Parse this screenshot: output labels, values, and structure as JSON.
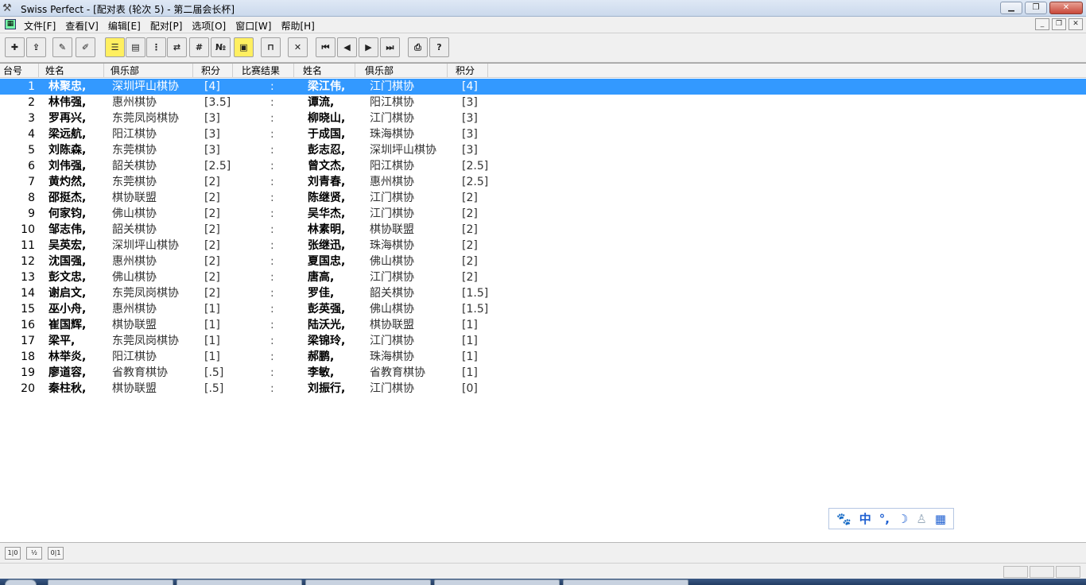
{
  "window": {
    "title": "Swiss Perfect - [配对表  (轮次 5) - 第二届会长杯]"
  },
  "menu": {
    "items": [
      "文件[F]",
      "查看[V]",
      "编辑[E]",
      "配对[P]",
      "选项[O]",
      "窗口[W]",
      "帮助[H]"
    ]
  },
  "columns": {
    "board": "台号",
    "name1": "姓名",
    "club1": "俱乐部",
    "pts1": "积分",
    "result": "比赛结果",
    "name2": "姓名",
    "club2": "俱乐部",
    "pts2": "积分"
  },
  "pairings": [
    {
      "board": "1",
      "name1": "林聚忠,",
      "club1": "深圳坪山棋协",
      "pts1": "[4]",
      "result": ":",
      "name2": "梁江伟,",
      "club2": "江门棋协",
      "pts2": "[4]"
    },
    {
      "board": "2",
      "name1": "林伟强,",
      "club1": "惠州棋协",
      "pts1": "[3.5]",
      "result": ":",
      "name2": "谭流,",
      "club2": "阳江棋协",
      "pts2": "[3]"
    },
    {
      "board": "3",
      "name1": "罗再兴,",
      "club1": "东莞凤岗棋协",
      "pts1": "[3]",
      "result": ":",
      "name2": "柳晓山,",
      "club2": "江门棋协",
      "pts2": "[3]"
    },
    {
      "board": "4",
      "name1": "梁远航,",
      "club1": "阳江棋协",
      "pts1": "[3]",
      "result": ":",
      "name2": "于成国,",
      "club2": "珠海棋协",
      "pts2": "[3]"
    },
    {
      "board": "5",
      "name1": "刘陈森,",
      "club1": "东莞棋协",
      "pts1": "[3]",
      "result": ":",
      "name2": "彭志忍,",
      "club2": "深圳坪山棋协",
      "pts2": "[3]"
    },
    {
      "board": "6",
      "name1": "刘伟强,",
      "club1": "韶关棋协",
      "pts1": "[2.5]",
      "result": ":",
      "name2": "曾文杰,",
      "club2": "阳江棋协",
      "pts2": "[2.5]"
    },
    {
      "board": "7",
      "name1": "黄灼然,",
      "club1": "东莞棋协",
      "pts1": "[2]",
      "result": ":",
      "name2": "刘青春,",
      "club2": "惠州棋协",
      "pts2": "[2.5]"
    },
    {
      "board": "8",
      "name1": "邵挺杰,",
      "club1": "棋协联盟",
      "pts1": "[2]",
      "result": ":",
      "name2": "陈继贤,",
      "club2": "江门棋协",
      "pts2": "[2]"
    },
    {
      "board": "9",
      "name1": "何家钧,",
      "club1": "佛山棋协",
      "pts1": "[2]",
      "result": ":",
      "name2": "吴华杰,",
      "club2": "江门棋协",
      "pts2": "[2]"
    },
    {
      "board": "10",
      "name1": "邹志伟,",
      "club1": "韶关棋协",
      "pts1": "[2]",
      "result": ":",
      "name2": "林素明,",
      "club2": "棋协联盟",
      "pts2": "[2]"
    },
    {
      "board": "11",
      "name1": "吴英宏,",
      "club1": "深圳坪山棋协",
      "pts1": "[2]",
      "result": ":",
      "name2": "张继迅,",
      "club2": "珠海棋协",
      "pts2": "[2]"
    },
    {
      "board": "12",
      "name1": "沈国强,",
      "club1": "惠州棋协",
      "pts1": "[2]",
      "result": ":",
      "name2": "夏国忠,",
      "club2": "佛山棋协",
      "pts2": "[2]"
    },
    {
      "board": "13",
      "name1": "彭文忠,",
      "club1": "佛山棋协",
      "pts1": "[2]",
      "result": ":",
      "name2": "唐高,",
      "club2": "江门棋协",
      "pts2": "[2]"
    },
    {
      "board": "14",
      "name1": "谢启文,",
      "club1": "东莞凤岗棋协",
      "pts1": "[2]",
      "result": ":",
      "name2": "罗佳,",
      "club2": "韶关棋协",
      "pts2": "[1.5]"
    },
    {
      "board": "15",
      "name1": "巫小舟,",
      "club1": "惠州棋协",
      "pts1": "[1]",
      "result": ":",
      "name2": "彭英强,",
      "club2": "佛山棋协",
      "pts2": "[1.5]"
    },
    {
      "board": "16",
      "name1": "崔国辉,",
      "club1": "棋协联盟",
      "pts1": "[1]",
      "result": ":",
      "name2": "陆沃光,",
      "club2": "棋协联盟",
      "pts2": "[1]"
    },
    {
      "board": "17",
      "name1": "梁平,",
      "club1": "东莞凤岗棋协",
      "pts1": "[1]",
      "result": ":",
      "name2": "梁锦玲,",
      "club2": "江门棋协",
      "pts2": "[1]"
    },
    {
      "board": "18",
      "name1": "林举炎,",
      "club1": "阳江棋协",
      "pts1": "[1]",
      "result": ":",
      "name2": "郝鹏,",
      "club2": "珠海棋协",
      "pts2": "[1]"
    },
    {
      "board": "19",
      "name1": "廖道容,",
      "club1": "省教育棋协",
      "pts1": "[.5]",
      "result": ":",
      "name2": "李敏,",
      "club2": "省教育棋协",
      "pts2": "[1]"
    },
    {
      "board": "20",
      "name1": "秦柱秋,",
      "club1": "棋协联盟",
      "pts1": "[.5]",
      "result": ":",
      "name2": "刘振行,",
      "club2": "江门棋协",
      "pts2": "[0]"
    }
  ],
  "selected_board": "1",
  "ime": {
    "mode_label": "中"
  },
  "footer": {
    "buttons": [
      "1|0",
      "½",
      "0|1"
    ]
  },
  "colors": {
    "selection": "#3399ff"
  }
}
